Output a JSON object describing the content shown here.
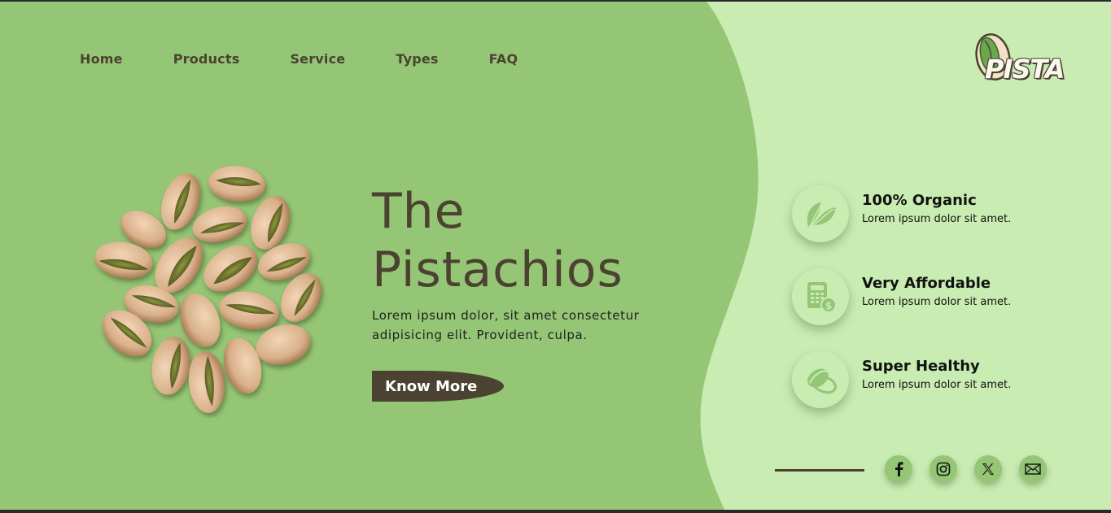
{
  "nav": {
    "items": [
      {
        "label": "Home"
      },
      {
        "label": "Products"
      },
      {
        "label": "Service"
      },
      {
        "label": "Types"
      },
      {
        "label": "FAQ"
      }
    ]
  },
  "logo": {
    "text": "PISTA"
  },
  "hero": {
    "title_line1": "The",
    "title_line2": "Pistachios",
    "description": "Lorem ipsum dolor, sit amet consectetur adipisicing elit. Provident, culpa.",
    "button_label": "Know More"
  },
  "features": [
    {
      "title": "100% Organic",
      "desc": "Lorem ipsum dolor sit amet.",
      "icon": "leaf-icon"
    },
    {
      "title": "Very Affordable",
      "desc": "Lorem ipsum dolor sit amet.",
      "icon": "calculator-money-icon"
    },
    {
      "title": "Super Healthy",
      "desc": "Lorem ipsum dolor sit amet.",
      "icon": "pistachio-icon"
    }
  ],
  "socials": [
    {
      "icon": "facebook-icon"
    },
    {
      "icon": "instagram-icon"
    },
    {
      "icon": "x-icon"
    },
    {
      "icon": "mail-icon"
    }
  ],
  "colors": {
    "primary_green": "#95c675",
    "light_green": "#c9ecb2",
    "dark_brown": "#4b4232"
  }
}
